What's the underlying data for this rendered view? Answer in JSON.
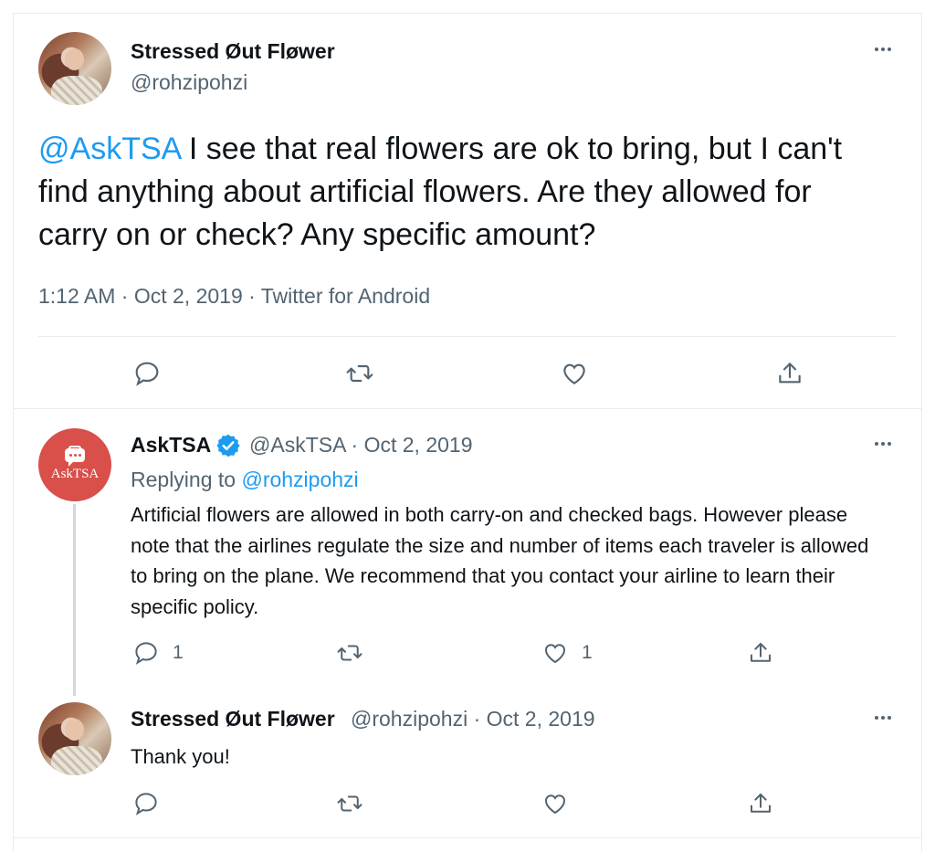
{
  "tweet": {
    "author_name": "Stressed Øut Fløwer",
    "author_handle": "@rohzipohzi",
    "mention": "@AskTSA",
    "text": " I see that real flowers are ok to bring, but I can't find anything about artificial flowers. Are they allowed for carry on or check? Any specific amount?",
    "meta": "1:12 AM · Oct 2, 2019 · Twitter for Android"
  },
  "reply1": {
    "author_name": "AskTSA",
    "handle_date": "@AskTSA · Oct 2, 2019",
    "avatar_label": "AskTSA",
    "replying_prefix": "Replying to ",
    "replying_handle": "@rohzipohzi",
    "text": "Artificial flowers are allowed in both carry-on and checked bags. However please note that the airlines regulate the size and number of items each traveler is allowed to bring on the plane. We recommend that you contact your airline to learn their specific policy.",
    "reply_count": "1",
    "like_count": "1"
  },
  "reply2": {
    "author_name": "Stressed Øut Fløwer",
    "handle_date": "@rohzipohzi · Oct 2, 2019",
    "text": "Thank you!"
  },
  "icons": {
    "reply": "reply-icon",
    "retweet": "retweet-icon",
    "like": "like-icon",
    "share": "share-icon",
    "more": "more-icon",
    "verified": "verified-badge-icon"
  },
  "colors": {
    "mention": "#1d9bf0",
    "secondary_text": "#536471",
    "tsa_avatar": "#d94f4a",
    "verified": "#1d9bf0"
  }
}
